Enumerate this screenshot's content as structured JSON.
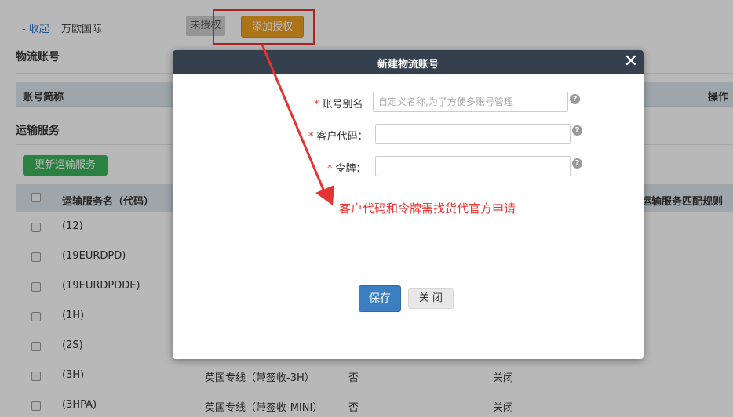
{
  "topbar": {
    "collapse_link": "- 收起",
    "company": "万欧国际",
    "unauth_badge": "未授权",
    "add_auth_button": "添加授权"
  },
  "sections": {
    "logistics_account": "物流账号",
    "transport_service": "运输服务"
  },
  "account_table": {
    "col_name": "账号简称",
    "col_operation": "操作"
  },
  "update_button": "更新运输服务",
  "service_table": {
    "col_service_name": "运输服务名（代码）",
    "col_match_rule": "运输服务匹配规则",
    "rows": [
      {
        "code": "(12)",
        "name": "",
        "flag": "",
        "status": ""
      },
      {
        "code": "(19EURDPD)",
        "name": "",
        "flag": "",
        "status": ""
      },
      {
        "code": "(19EURDPDDE)",
        "name": "",
        "flag": "",
        "status": ""
      },
      {
        "code": "(1H)",
        "name": "",
        "flag": "",
        "status": ""
      },
      {
        "code": "(2S)",
        "name": "",
        "flag": "",
        "status": ""
      },
      {
        "code": "(3H)",
        "name": "英国专线（带签收-3H）",
        "flag": "否",
        "status": "关闭"
      },
      {
        "code": "(3HPA)",
        "name": "英国专线（带签收-MINI）",
        "flag": "否",
        "status": "关闭"
      }
    ]
  },
  "modal": {
    "title": "新建物流账号",
    "close_symbol": "✕",
    "fields": {
      "alias": {
        "label": "账号别名",
        "placeholder": "自定义名称,为了方便多账号管理",
        "value": ""
      },
      "customer_code": {
        "label": "客户代码：",
        "placeholder": "",
        "value": ""
      },
      "token": {
        "label": "令牌：",
        "placeholder": "",
        "value": ""
      }
    },
    "required_mark": "*",
    "help_symbol": "?",
    "annotation": "客户代码和令牌需找货代官方申请",
    "save_button": "保存",
    "close_button": "关 闭"
  },
  "colors": {
    "accent_orange": "#f0a020",
    "accent_green": "#3cb35a",
    "modal_header": "#34404e",
    "primary_blue": "#3a7fc1",
    "annotation_red": "#e33333"
  }
}
